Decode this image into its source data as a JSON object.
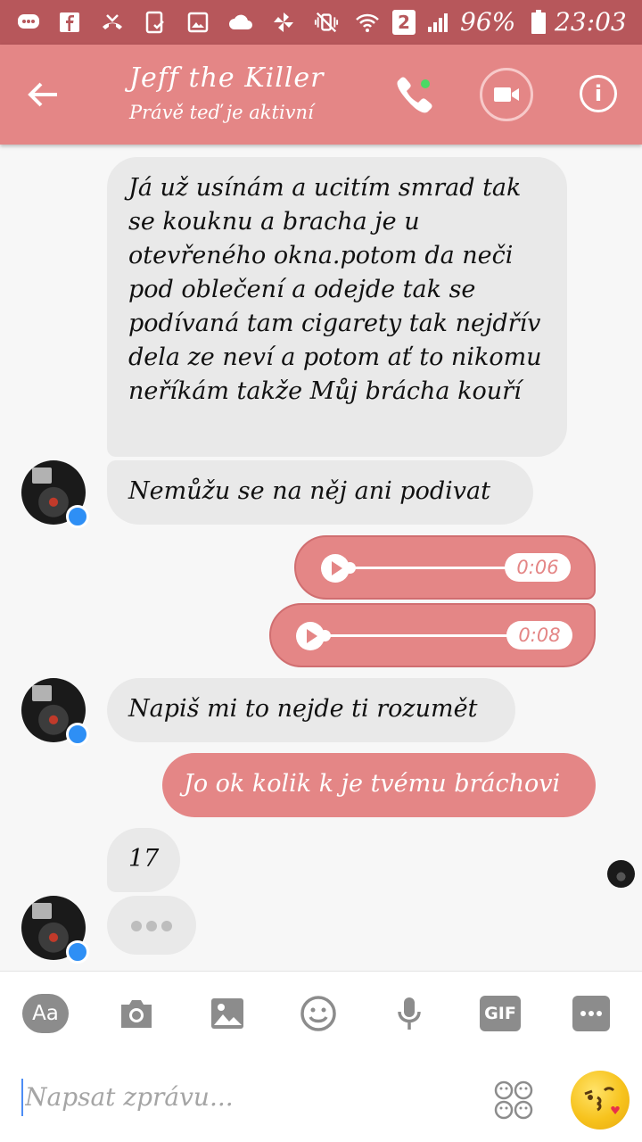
{
  "status_bar": {
    "sim_badge": "2",
    "battery": "96%",
    "time": "23:03"
  },
  "header": {
    "contact_name": "Jeff the Killer",
    "contact_status": "Právě teď je aktivní",
    "accent_color": "#e48686",
    "status_bar_color": "#b7575b"
  },
  "messages": [
    {
      "from": "contact",
      "text": "Já už usínám a ucitím smrad tak se kouknu a bracha je u otevřeného okna.potom da neči pod oblečení a odejde tak se podívaná tam cigarety tak nejdřív dela ze neví a potom ať to nikomu neříkám takže Můj brácha kouří"
    },
    {
      "from": "contact",
      "text": "Nemůžu se na něj ani podivat"
    },
    {
      "from": "me",
      "type": "audio",
      "duration": "0:06"
    },
    {
      "from": "me",
      "type": "audio",
      "duration": "0:08"
    },
    {
      "from": "contact",
      "text": "Napiš mi to nejde ti rozumět"
    },
    {
      "from": "me",
      "text": "Jo ok kolik k je tvému bráchovi"
    },
    {
      "from": "contact",
      "text": "17"
    }
  ],
  "composer": {
    "aa_label": "Aa",
    "gif_label": "GIF",
    "placeholder": "Napsat zprávu..."
  }
}
